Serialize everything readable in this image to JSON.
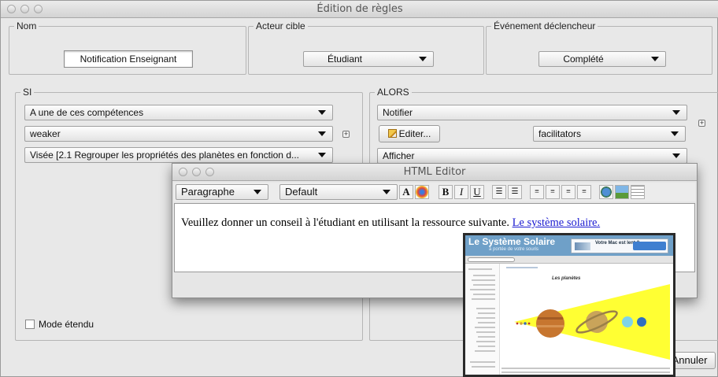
{
  "window": {
    "title": "Édition de règles"
  },
  "nom": {
    "legend": "Nom",
    "value": "Notification Enseignant"
  },
  "acteur": {
    "legend": "Acteur cible",
    "selected": "Étudiant"
  },
  "evenement": {
    "legend": "Événement déclencheur",
    "selected": "Complété"
  },
  "si": {
    "legend": "SI",
    "condition": "A une de ces compétences",
    "level": "weaker",
    "target": "Visée [2.1 Regrouper les propriétés  des planètes en fonction d..."
  },
  "alors": {
    "legend": "ALORS",
    "action": "Notifier",
    "edit_label": "Editer...",
    "recipient": "facilitators",
    "action2": "Afficher",
    "partial_button": "ler"
  },
  "mode_etendu": {
    "label": "Mode étendu",
    "checked": false
  },
  "footer": {
    "cancel_label": "Annuler"
  },
  "editor": {
    "title": "HTML Editor",
    "paragraph_style": "Paragraphe",
    "font": "Default",
    "toolbar": {
      "bold": "B",
      "italic": "I",
      "underline": "U"
    },
    "content_text": "Veuillez donner un conseil à l'étudiant en utilisant la ressource suivante. ",
    "content_link": "Le système solaire."
  },
  "preview": {
    "site_title": "Le Système Solaire",
    "site_subtitle": "à portée de votre souris",
    "ad_text": "Votre Mac est lent ?",
    "page_heading": "Les planètes",
    "colors": {
      "header": "#6fa0c8",
      "sun": "#ffff33"
    }
  }
}
